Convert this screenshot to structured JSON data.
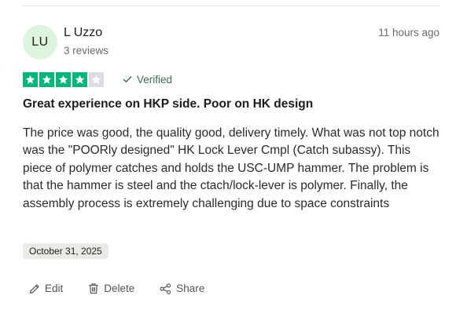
{
  "reviewer": {
    "initials": "LU",
    "name": "L Uzzo",
    "review_count": "3 reviews"
  },
  "review": {
    "time_ago": "11 hours ago",
    "rating": 4,
    "rating_max": 5,
    "verified_label": "Verified",
    "title": "Great experience on HKP side. Poor on HK design",
    "body": "The price was good, the quality good, delivery timely. What was not top notch was the \"POORly designed\" HK Lock Lever Cmpl (Catch subassy). This piece of polymer catches and holds the USC-UMP hammer. The problem is that the hammer is steel and the ctach/lock-lever is polymer. Finally, the assembly process is extremely challenging due to space constraints",
    "date": "October 31, 2025"
  },
  "actions": {
    "edit_label": "Edit",
    "delete_label": "Delete",
    "share_label": "Share"
  },
  "colors": {
    "star_on": "#00b67a",
    "star_off": "#dcdce6",
    "avatar_bg": "#dcf5dc",
    "verified": "#3d6b4a"
  },
  "icons": {
    "star": "star-icon",
    "verified": "check-icon",
    "edit": "pencil-icon",
    "delete": "trash-icon",
    "share": "share-icon"
  }
}
